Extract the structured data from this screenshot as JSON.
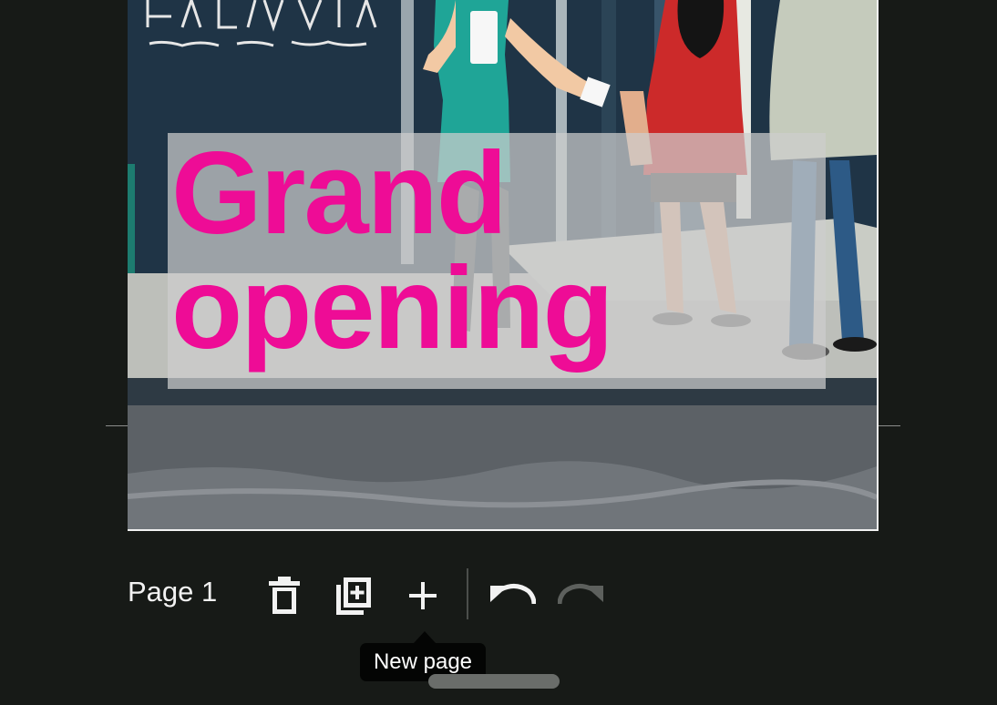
{
  "canvas": {
    "headline_line1": "Grand",
    "headline_line2": "opening",
    "headline_color": "#ee0c96",
    "illustration": "storefront-people-illustration"
  },
  "toolbar": {
    "page_label": "Page 1",
    "tools": [
      {
        "name": "delete-page",
        "icon": "trash-icon"
      },
      {
        "name": "duplicate-page",
        "icon": "duplicate-page-icon"
      },
      {
        "name": "new-page",
        "icon": "plus-icon"
      },
      {
        "name": "undo",
        "icon": "undo-icon"
      },
      {
        "name": "redo",
        "icon": "redo-icon",
        "disabled": true
      }
    ]
  },
  "tooltip": {
    "text": "New page"
  },
  "colors": {
    "background": "#171a17",
    "icon": "#f2f2f2",
    "icon_disabled": "#5d605d",
    "tooltip_bg": "#040504"
  }
}
